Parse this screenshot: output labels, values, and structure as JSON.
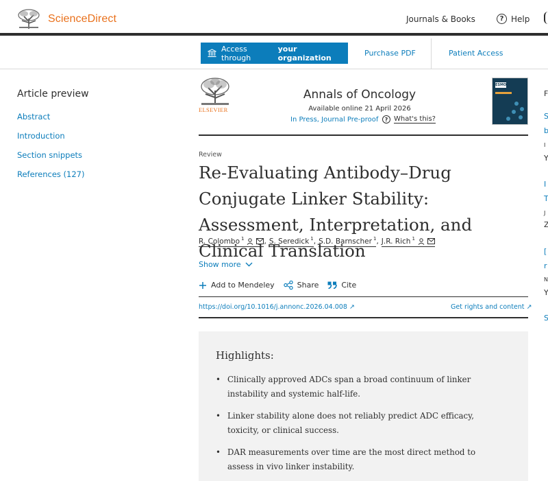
{
  "header": {
    "brand": "ScienceDirect",
    "journals_books": "Journals & Books",
    "help": "Help"
  },
  "access_bar": {
    "access_prefix": "Access through",
    "access_bold": "your organization",
    "purchase_pdf": "Purchase PDF",
    "patient_access": "Patient Access"
  },
  "sidebar": {
    "title": "Article preview",
    "links": [
      "Abstract",
      "Introduction",
      "Section snippets",
      "References (127)"
    ]
  },
  "journal": {
    "publisher": "ELSEVIER",
    "name": "Annals of Oncology",
    "available": "Available online 21 April 2026",
    "status": "In Press, Journal Pre-proof",
    "whats_this": "What's this?"
  },
  "article": {
    "type": "Review",
    "title": "Re-Evaluating Antibody–Drug Conjugate Linker Stability: Assessment, Interpretation, and Clinical Translation",
    "authors": [
      {
        "name": "R. Colombo",
        "sup": "1"
      },
      {
        "name": "S. Seredick",
        "sup": "1"
      },
      {
        "name": "S.D. Barnscher",
        "sup": "1"
      },
      {
        "name": "J.R. Rich",
        "sup": "1"
      }
    ],
    "show_more": "Show more",
    "actions": {
      "mendeley": "Add to Mendeley",
      "share": "Share",
      "cite": "Cite"
    },
    "doi": "https://doi.org/10.1016/j.annonc.2026.04.008 ↗",
    "rights": "Get rights and content ↗"
  },
  "highlights": {
    "title": "Highlights:",
    "items": [
      "Clinically approved ADCs span a broad continuum of linker instability and systemic half-life.",
      "Linker stability alone does not reliably predict ADC efficacy, toxicity, or clinical success.",
      "DAR measurements over time are the most direct method to assess in vivo linker instability."
    ]
  },
  "right_column": {
    "fragments": [
      "F",
      "S",
      "b",
      "I",
      "Y",
      "I",
      "T",
      "J",
      "Z",
      "[",
      "r",
      "N",
      "Y",
      "S"
    ]
  },
  "colors": {
    "accent": "#0c7dbb",
    "brand_orange": "#e9711c",
    "text": "#2e2e2e",
    "highlight_bg": "#f2f2f2"
  }
}
